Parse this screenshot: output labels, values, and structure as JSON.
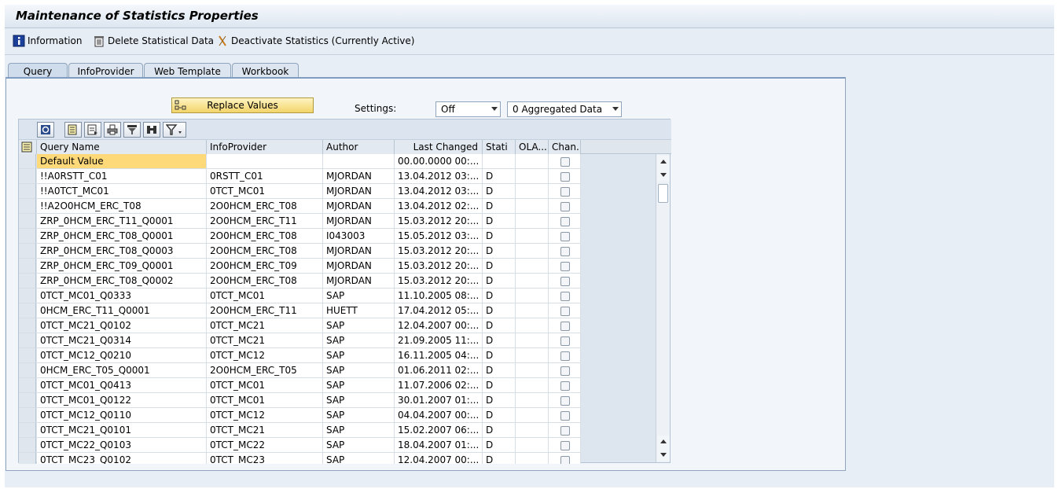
{
  "window": {
    "title": "Maintenance of Statistics Properties"
  },
  "toolbar": {
    "information": "Information",
    "delete_statistical_data": "Delete Statistical Data",
    "deactivate_statistics": "Deactivate Statistics (Currently Active)"
  },
  "tabs": [
    {
      "label": "Query",
      "active": true
    },
    {
      "label": "InfoProvider",
      "active": false
    },
    {
      "label": "Web Template",
      "active": false
    },
    {
      "label": "Workbook",
      "active": false
    }
  ],
  "controls": {
    "replace_values": "Replace Values",
    "settings_label": "Settings:",
    "settings_value": "Off",
    "aggregation_value": "0 Aggregated Data"
  },
  "grid": {
    "headers": {
      "query_name": "Query Name",
      "infoprovider": "InfoProvider",
      "author": "Author",
      "last_changed": "Last Changed",
      "statistics": "Stati",
      "olap": "OLA...",
      "changed": "Chan..."
    },
    "rows": [
      {
        "query": "Default Value",
        "infoprovider": "",
        "author": "",
        "last_changed": "00.00.0000  00:...",
        "stat": "",
        "olap": "",
        "highlight": true
      },
      {
        "query": "!!A0RSTT_C01",
        "infoprovider": "0RSTT_C01",
        "author": "MJORDAN",
        "last_changed": "13.04.2012  03:...",
        "stat": "D",
        "olap": ""
      },
      {
        "query": "!!A0TCT_MC01",
        "infoprovider": "0TCT_MC01",
        "author": "MJORDAN",
        "last_changed": "13.04.2012  03:...",
        "stat": "D",
        "olap": ""
      },
      {
        "query": "!!A2O0HCM_ERC_T08",
        "infoprovider": "2O0HCM_ERC_T08",
        "author": "MJORDAN",
        "last_changed": "13.04.2012  02:...",
        "stat": "D",
        "olap": ""
      },
      {
        "query": "ZRP_0HCM_ERC_T11_Q0001",
        "infoprovider": "2O0HCM_ERC_T11",
        "author": "MJORDAN",
        "last_changed": "15.03.2012  20:...",
        "stat": "D",
        "olap": ""
      },
      {
        "query": "ZRP_0HCM_ERC_T08_Q0001",
        "infoprovider": "2O0HCM_ERC_T08",
        "author": "I043003",
        "last_changed": "15.05.2012  03:...",
        "stat": "D",
        "olap": ""
      },
      {
        "query": "ZRP_0HCM_ERC_T08_Q0003",
        "infoprovider": "2O0HCM_ERC_T08",
        "author": "MJORDAN",
        "last_changed": "15.03.2012  20:...",
        "stat": "D",
        "olap": ""
      },
      {
        "query": "ZRP_0HCM_ERC_T09_Q0001",
        "infoprovider": "2O0HCM_ERC_T09",
        "author": "MJORDAN",
        "last_changed": "15.03.2012  20:...",
        "stat": "D",
        "olap": ""
      },
      {
        "query": "ZRP_0HCM_ERC_T08_Q0002",
        "infoprovider": "2O0HCM_ERC_T08",
        "author": "MJORDAN",
        "last_changed": "15.03.2012  20:...",
        "stat": "D",
        "olap": ""
      },
      {
        "query": "0TCT_MC01_Q0333",
        "infoprovider": "0TCT_MC01",
        "author": "SAP",
        "last_changed": "11.10.2005  08:...",
        "stat": "D",
        "olap": ""
      },
      {
        "query": "0HCM_ERC_T11_Q0001",
        "infoprovider": "2O0HCM_ERC_T11",
        "author": "HUETT",
        "last_changed": "17.04.2012  05:...",
        "stat": "D",
        "olap": ""
      },
      {
        "query": "0TCT_MC21_Q0102",
        "infoprovider": "0TCT_MC21",
        "author": "SAP",
        "last_changed": "12.04.2007  00:...",
        "stat": "D",
        "olap": ""
      },
      {
        "query": "0TCT_MC21_Q0314",
        "infoprovider": "0TCT_MC21",
        "author": "SAP",
        "last_changed": "21.09.2005  11:...",
        "stat": "D",
        "olap": ""
      },
      {
        "query": "0TCT_MC12_Q0210",
        "infoprovider": "0TCT_MC12",
        "author": "SAP",
        "last_changed": "16.11.2005  04:...",
        "stat": "D",
        "olap": ""
      },
      {
        "query": "0HCM_ERC_T05_Q0001",
        "infoprovider": "2O0HCM_ERC_T05",
        "author": "SAP",
        "last_changed": "01.06.2011  02:...",
        "stat": "D",
        "olap": ""
      },
      {
        "query": "0TCT_MC01_Q0413",
        "infoprovider": "0TCT_MC01",
        "author": "SAP",
        "last_changed": "11.07.2006  02:...",
        "stat": "D",
        "olap": ""
      },
      {
        "query": "0TCT_MC01_Q0122",
        "infoprovider": "0TCT_MC01",
        "author": "SAP",
        "last_changed": "30.01.2007  01:...",
        "stat": "D",
        "olap": ""
      },
      {
        "query": "0TCT_MC12_Q0110",
        "infoprovider": "0TCT_MC12",
        "author": "SAP",
        "last_changed": "04.04.2007  00:...",
        "stat": "D",
        "olap": ""
      },
      {
        "query": "0TCT_MC21_Q0101",
        "infoprovider": "0TCT_MC21",
        "author": "SAP",
        "last_changed": "15.02.2007  06:...",
        "stat": "D",
        "olap": ""
      },
      {
        "query": "0TCT_MC22_Q0103",
        "infoprovider": "0TCT_MC22",
        "author": "SAP",
        "last_changed": "18.04.2007  01:...",
        "stat": "D",
        "olap": ""
      },
      {
        "query": "0TCT_MC23_Q0102",
        "infoprovider": "0TCT_MC23",
        "author": "SAP",
        "last_changed": "12.04.2007  00:...",
        "stat": "D",
        "olap": ""
      }
    ]
  },
  "colors": {
    "highlight_row": "#fdd97a",
    "accent_border": "#7f9dc0",
    "button_yellow": "#f2d46a"
  }
}
